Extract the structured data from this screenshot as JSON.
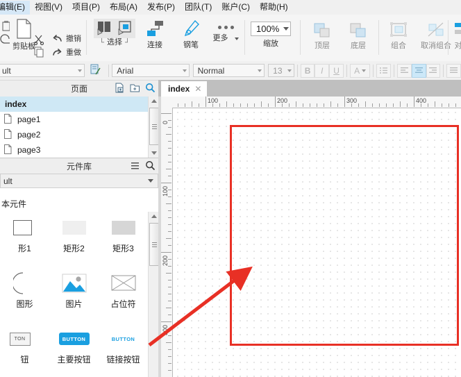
{
  "menubar": {
    "items": [
      {
        "label": "编辑(E)",
        "name": "menu-edit"
      },
      {
        "label": "视图(V)",
        "name": "menu-view"
      },
      {
        "label": "项目(P)",
        "name": "menu-project"
      },
      {
        "label": "布局(A)",
        "name": "menu-layout"
      },
      {
        "label": "发布(P)",
        "name": "menu-publish"
      },
      {
        "label": "团队(T)",
        "name": "menu-team"
      },
      {
        "label": "账户(C)",
        "name": "menu-account"
      },
      {
        "label": "帮助(H)",
        "name": "menu-help"
      }
    ]
  },
  "ribbon": {
    "clipboard_label": "剪贴板",
    "undo_label": "撤销",
    "redo_label": "重做",
    "select_label": "选择",
    "connect_label": "连接",
    "pen_label": "钢笔",
    "more_label": "更多",
    "zoom_value": "100%",
    "zoom_label": "缩放",
    "front_label": "顶层",
    "back_label": "底层",
    "group_label": "组合",
    "ungroup_label": "取消组合",
    "align_label": "对"
  },
  "formatbar": {
    "style_value": "ult",
    "font_value": "Arial",
    "weight_value": "Normal",
    "size_value": "13",
    "bold_label": "B",
    "italic_label": "I",
    "underline_label": "U",
    "textcolor_label": "A",
    "accent_color": "#cce8f8"
  },
  "pages_panel": {
    "title": "页面",
    "icons": [
      "add-page-icon",
      "add-folder-icon",
      "search-icon"
    ],
    "items": [
      {
        "label": "index",
        "selected": true
      },
      {
        "label": "page1",
        "selected": false
      },
      {
        "label": "page2",
        "selected": false
      },
      {
        "label": "page3",
        "selected": false
      }
    ]
  },
  "library_panel": {
    "title": "元件库",
    "icons": [
      "menu-icon",
      "search-icon"
    ],
    "selected_library": "ult",
    "section_label": "本元件",
    "widgets": [
      {
        "label": "形1",
        "icon": "rectangle-outline-icon"
      },
      {
        "label": "矩形2",
        "icon": "rectangle-light-icon"
      },
      {
        "label": "矩形3",
        "icon": "rectangle-gray-icon"
      },
      {
        "label": "图形",
        "icon": "circle-icon"
      },
      {
        "label": "图片",
        "icon": "image-icon"
      },
      {
        "label": "占位符",
        "icon": "placeholder-icon"
      },
      {
        "label": "钮",
        "icon": "button-icon"
      },
      {
        "label": "主要按钮",
        "icon": "primary-button-icon"
      },
      {
        "label": "链接按钮",
        "icon": "link-button-icon"
      }
    ],
    "button_glyph": "BUTTON",
    "button_glyph_small": "TON"
  },
  "canvas": {
    "tab_label": "index",
    "tab_close": "✕",
    "ruler_h_labels": [
      "100",
      "200",
      "300",
      "400"
    ],
    "ruler_v_labels": [
      "0",
      "100",
      "200",
      "300"
    ],
    "annotation_color": "#e83025",
    "rectangle": {
      "left": "82",
      "top": "24",
      "width": "330",
      "height": "318"
    }
  }
}
